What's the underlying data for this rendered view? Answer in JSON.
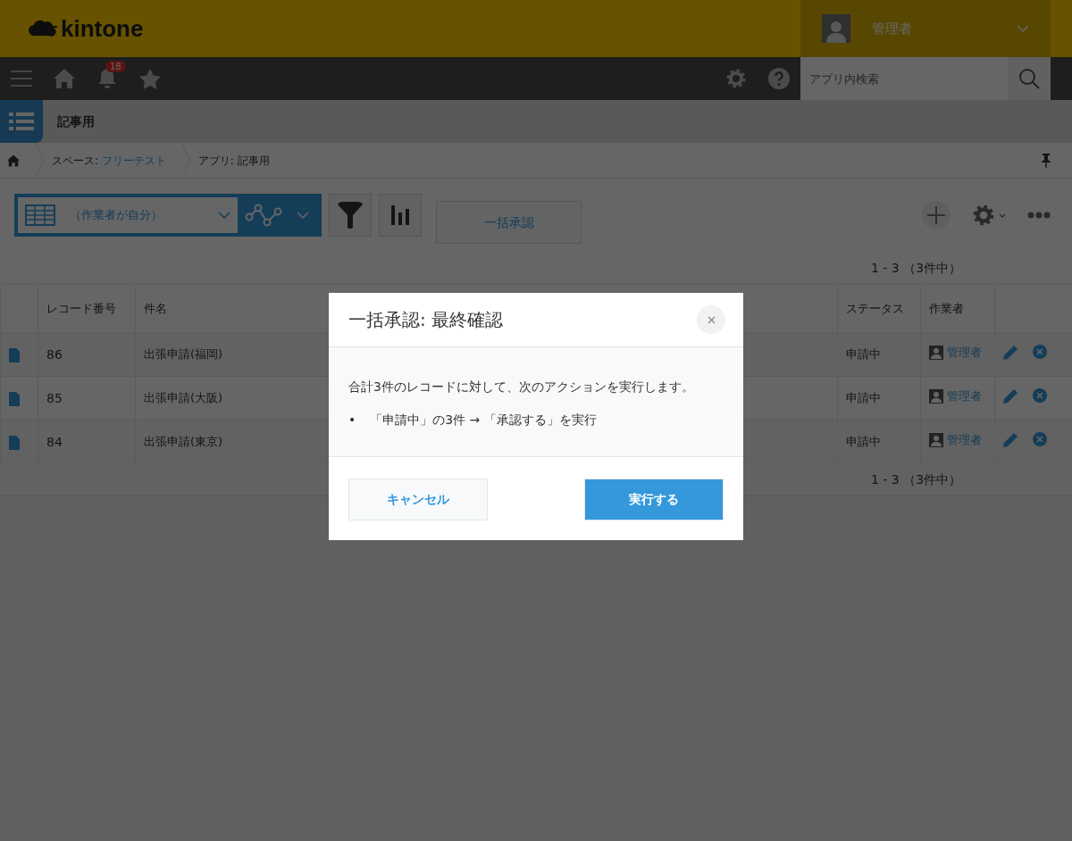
{
  "header": {
    "logo": "kintone",
    "user": "管理者"
  },
  "nav": {
    "notification_count": "18",
    "search": {
      "placeholder": "アプリ内検索"
    }
  },
  "app": {
    "title": "記事用"
  },
  "breadcrumb": [
    {
      "label": "スペース:",
      "value": "フリーテスト",
      "kind": "link"
    },
    {
      "label": "アプリ:",
      "value": "記事用",
      "kind": "text"
    }
  ],
  "toolbar": {
    "view": "（作業者が自分）",
    "bulk_button": "一括承認"
  },
  "count_top": "1 - 3 （3件中）",
  "table": {
    "columns": [
      "レコード番号",
      "件名",
      "ステータス",
      "作業者"
    ],
    "rows": [
      {
        "number": "86",
        "title": "出張申請(福岡)",
        "status": "申請中",
        "assignee": "管理者"
      },
      {
        "number": "85",
        "title": "出張申請(大阪)",
        "status": "申請中",
        "assignee": "管理者"
      },
      {
        "number": "84",
        "title": "出張申請(東京)",
        "status": "申請中",
        "assignee": "管理者"
      }
    ]
  },
  "count_bottom": "1 - 3 （3件中）",
  "dialog": {
    "title": "一括承認: 最終確認",
    "message": "合計3件のレコードに対して、次のアクションを実行します。",
    "items": [
      {
        "bullet": "•",
        "text": "「申請中」の3件 → 「承認する」を実行"
      }
    ],
    "buttons": [
      {
        "label": "キャンセル",
        "kind": "secondary"
      },
      {
        "label": "実行する",
        "kind": "primary"
      }
    ]
  }
}
